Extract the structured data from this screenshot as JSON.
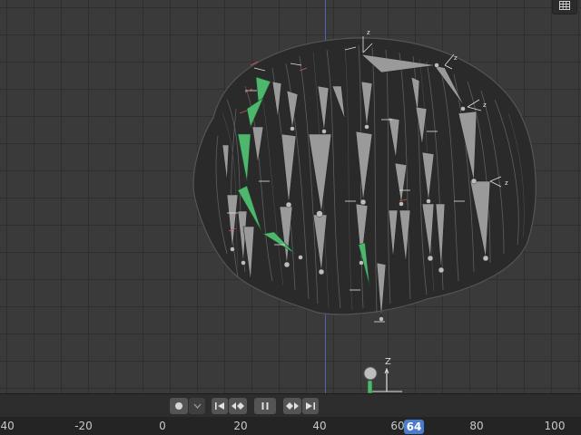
{
  "viewport": {
    "overlay_icon": "grid-icon",
    "axis_label": "Z",
    "head_bone_labels": [
      "z",
      "z",
      "z",
      "z"
    ]
  },
  "playback": {
    "buttons": [
      {
        "name": "record-button",
        "icon": "circle-icon"
      },
      {
        "name": "record-options-dropdown",
        "icon": "chevron-down-icon"
      },
      {
        "name": "jump-to-start-button",
        "icon": "jump-start-icon"
      },
      {
        "name": "previous-keyframe-button",
        "icon": "prev-keyframe-icon"
      },
      {
        "name": "pause-button",
        "icon": "pause-icon"
      },
      {
        "name": "next-keyframe-button",
        "icon": "next-keyframe-icon"
      },
      {
        "name": "jump-to-end-button",
        "icon": "jump-end-icon"
      }
    ]
  },
  "timeline": {
    "ticks": [
      "-40",
      "-20",
      "0",
      "20",
      "40",
      "60",
      "80",
      "100"
    ],
    "current_frame": "64"
  },
  "colors": {
    "viewport_bg": "#3a3a3a",
    "bone_gray": "#9a9a9a",
    "bone_selected": "#4fb66e",
    "frame_badge": "#4b7bcd",
    "y_axis_line": "#5b67c8"
  }
}
